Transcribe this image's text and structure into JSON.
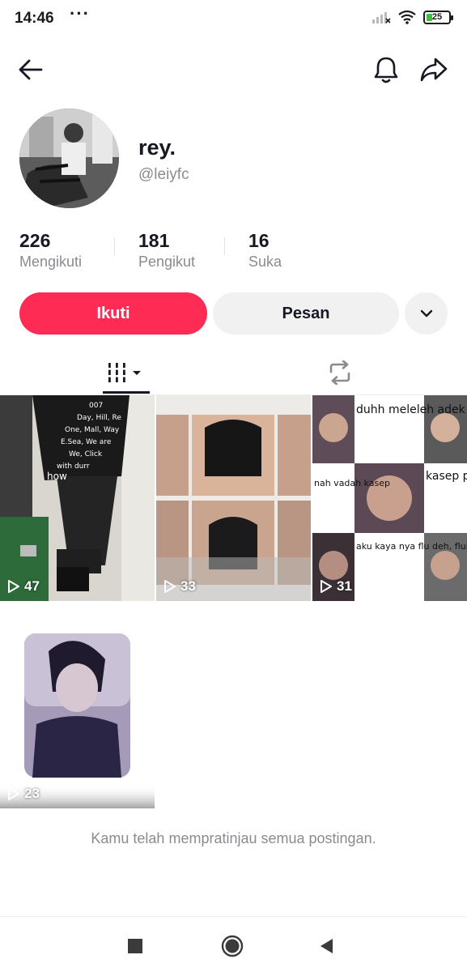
{
  "status_bar": {
    "time": "14:46",
    "dots": "···",
    "battery": "25",
    "battery_level": 0.25
  },
  "top_nav": {
    "back_icon": "arrow-left-icon",
    "bell_icon": "bell-icon",
    "share_icon": "share-arrow-icon"
  },
  "profile": {
    "display_name": "rey.",
    "username": "@leiyfc"
  },
  "stats": [
    {
      "value": "226",
      "label": "Mengikuti"
    },
    {
      "value": "181",
      "label": "Pengikut"
    },
    {
      "value": "16",
      "label": "Suka"
    }
  ],
  "actions": {
    "follow_label": "Ikuti",
    "message_label": "Pesan"
  },
  "tabs": {
    "videos_icon": "grid-bars-icon",
    "repost_icon": "repost-icon"
  },
  "videos": [
    {
      "views": "47",
      "caption": "how"
    },
    {
      "views": "33"
    },
    {
      "views": "31",
      "captions": [
        "duhh meleleh adek bang",
        "kasep pisan uey",
        "nah vadah kasep",
        "aku kaya nya flu deh, fluing love with you."
      ]
    },
    {
      "views": "23"
    }
  ],
  "end_message": "Kamu telah mempratinjau semua postingan.",
  "colors": {
    "accent": "#fe2c55",
    "secondary_button": "#f1f1f2",
    "muted_text": "#8a8b91"
  }
}
